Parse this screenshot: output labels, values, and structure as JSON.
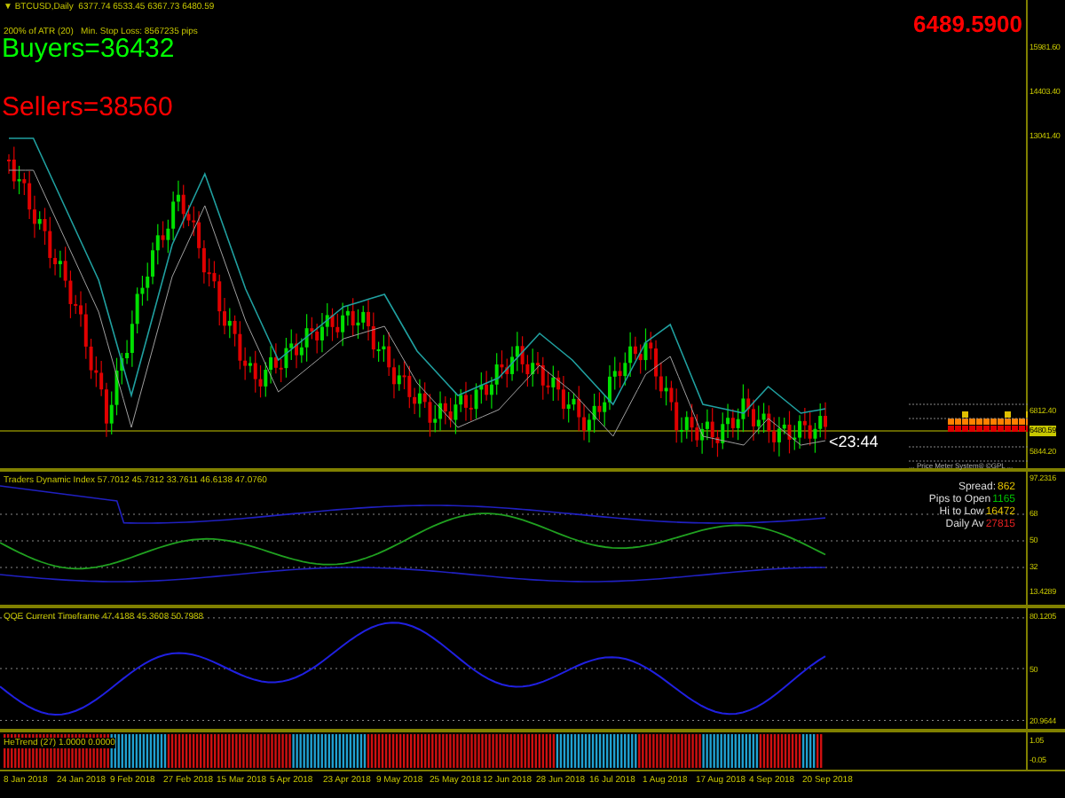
{
  "main_chart": {
    "symbol_line": "▼ BTCUSD,Daily  6377.74 6533.45 6367.73 6480.59",
    "atr_line": "200% of ATR (20)   Min. Stop Loss: 8567235 pips",
    "buyers": "Buyers=36432",
    "sellers": "Sellers=38560",
    "price": "6489.5900",
    "countdown": "<23:44",
    "meter_caption": "... Price Meter System® ©GPL ...",
    "axis": [
      {
        "label": "15981.60",
        "selected": false
      },
      {
        "label": "14403.40",
        "selected": false
      },
      {
        "label": "13041.40",
        "selected": false
      },
      {
        "label": "6812.40",
        "selected": false
      },
      {
        "label": "6480.59",
        "selected": true
      },
      {
        "label": "5844.20",
        "selected": false
      }
    ]
  },
  "tdi": {
    "title": "Traders Dynamic Index 57.7012 45.7312 33.7611 46.6138 47.0760",
    "info": [
      {
        "label": "Spread:",
        "value": "862",
        "color": "#e0c000"
      },
      {
        "label": "Pips to Open",
        "value": "1165",
        "color": "#00c000"
      },
      {
        "label": "Hi to Low",
        "value": "16472",
        "color": "#e0c000"
      },
      {
        "label": "Daily Av",
        "value": "27815",
        "color": "#e02020"
      }
    ],
    "axis": [
      "97.2316",
      "68",
      "50",
      "32",
      "13.4289"
    ]
  },
  "qqe": {
    "title": "QQE Current Timeframe 47.4188 45.3608 50.7988",
    "axis": [
      "80.1205",
      "50",
      "20.9644"
    ]
  },
  "hetrend": {
    "title": "HeTrend (27) 1.0000 0.0000",
    "axis": [
      "1.05",
      "-0.05"
    ]
  },
  "dates": [
    "8 Jan 2018",
    "24 Jan 2018",
    "9 Feb 2018",
    "27 Feb 2018",
    "15 Mar 2018",
    "5 Apr 2018",
    "23 Apr 2018",
    "9 May 2018",
    "25 May 2018",
    "12 Jun 2018",
    "28 Jun 2018",
    "16 Jul 2018",
    "1 Aug 2018",
    "17 Aug 2018",
    "4 Sep 2018",
    "20 Sep 2018"
  ]
}
